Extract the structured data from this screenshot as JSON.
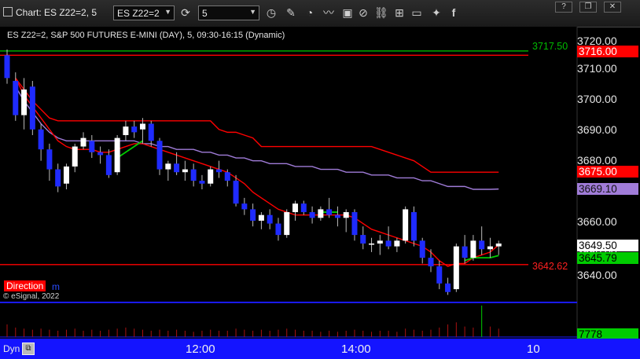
{
  "window": {
    "title": "Chart: ES Z22=2, 5",
    "symbol_value": "ES Z22=2",
    "interval_value": "5",
    "buttons": {
      "help": "?",
      "restore": "❐",
      "close": "✕"
    }
  },
  "chart": {
    "subtitle": "ES Z22=2, S&P 500 FUTURES E-MINI (DAY), 5, 09:30-16:15 (Dynamic)",
    "price_axis": [
      "3720.00",
      "3710.00",
      "3700.00",
      "3690.00",
      "3680.00",
      "3670.00",
      "3660.00",
      "3650.00",
      "3640.00"
    ],
    "time_axis": [
      "12:00",
      "14:00",
      "10"
    ],
    "tags": {
      "green_line": "3717.50",
      "red_top": "3716.00",
      "red_mid": "3675.00",
      "purple": "3669.10",
      "last": "3649.50",
      "green_ma": "3645.79",
      "red_low": "3642.62",
      "volume": "7778"
    },
    "direction_label": "Direction",
    "direction_suffix": "m",
    "copyright": "© eSignal, 2022",
    "footer_label": "Dyn",
    "colors": {
      "red": "#ff0000",
      "purple": "#a07cd8",
      "green": "#00cc00",
      "blue_candle": "#1f2bff",
      "footer": "#1414ff"
    }
  },
  "chart_data": {
    "type": "line",
    "y_range": [
      3631,
      3726
    ],
    "candles": [
      [
        3716,
        3718,
        3706,
        3708
      ],
      [
        3707,
        3710,
        3693,
        3695
      ],
      [
        3695,
        3708,
        3690,
        3704
      ],
      [
        3705,
        3707,
        3688,
        3690
      ],
      [
        3690,
        3692,
        3679,
        3683
      ],
      [
        3683,
        3685,
        3672,
        3676
      ],
      [
        3676,
        3678,
        3668,
        3670
      ],
      [
        3671,
        3678,
        3669,
        3677
      ],
      [
        3677,
        3685,
        3675,
        3684
      ],
      [
        3684,
        3689,
        3683,
        3687
      ],
      [
        3686,
        3688,
        3680,
        3682
      ],
      [
        3682,
        3684,
        3678,
        3681
      ],
      [
        3681,
        3683,
        3673,
        3674
      ],
      [
        3675,
        3688,
        3674,
        3687
      ],
      [
        3688,
        3693,
        3686,
        3691
      ],
      [
        3691,
        3693,
        3687,
        3689
      ],
      [
        3690,
        3694,
        3685,
        3692
      ],
      [
        3692,
        3693,
        3684,
        3686
      ],
      [
        3686,
        3687,
        3674,
        3676
      ],
      [
        3676,
        3679,
        3672,
        3678
      ],
      [
        3678,
        3682,
        3674,
        3675
      ],
      [
        3675,
        3679,
        3672,
        3676
      ],
      [
        3676,
        3678,
        3670,
        3672
      ],
      [
        3672,
        3674,
        3669,
        3671
      ],
      [
        3671,
        3677,
        3670,
        3676
      ],
      [
        3676,
        3679,
        3673,
        3675
      ],
      [
        3675,
        3676,
        3670,
        3672
      ],
      [
        3672,
        3674,
        3663,
        3664
      ],
      [
        3664,
        3666,
        3660,
        3662
      ],
      [
        3662,
        3664,
        3656,
        3658
      ],
      [
        3658,
        3661,
        3655,
        3660
      ],
      [
        3660,
        3662,
        3655,
        3657
      ],
      [
        3657,
        3659,
        3651,
        3653
      ],
      [
        3653,
        3662,
        3652,
        3661
      ],
      [
        3661,
        3665,
        3658,
        3664
      ],
      [
        3664,
        3665,
        3660,
        3661
      ],
      [
        3661,
        3663,
        3657,
        3659
      ],
      [
        3659,
        3663,
        3658,
        3662
      ],
      [
        3662,
        3666,
        3659,
        3660
      ],
      [
        3660,
        3663,
        3656,
        3659
      ],
      [
        3659,
        3662,
        3654,
        3661
      ],
      [
        3661,
        3662,
        3651,
        3653
      ],
      [
        3653,
        3656,
        3648,
        3650
      ],
      [
        3650,
        3652,
        3647,
        3650
      ],
      [
        3650,
        3653,
        3646,
        3651
      ],
      [
        3651,
        3656,
        3648,
        3649
      ],
      [
        3649,
        3652,
        3647,
        3651
      ],
      [
        3651,
        3663,
        3650,
        3662
      ],
      [
        3661,
        3663,
        3649,
        3651
      ],
      [
        3651,
        3652,
        3643,
        3645
      ],
      [
        3645,
        3648,
        3640,
        3642
      ],
      [
        3642,
        3644,
        3634,
        3636
      ],
      [
        3636,
        3638,
        3632,
        3633
      ],
      [
        3634,
        3650,
        3633,
        3649
      ],
      [
        3649,
        3653,
        3643,
        3645
      ],
      [
        3645,
        3653,
        3644,
        3651
      ],
      [
        3651,
        3656,
        3646,
        3648
      ],
      [
        3648,
        3652,
        3645,
        3649
      ],
      [
        3649,
        3651,
        3646,
        3650
      ]
    ],
    "volume": [
      12,
      9,
      8,
      7,
      8,
      7,
      6,
      7,
      8,
      6,
      7,
      6,
      7,
      8,
      9,
      8,
      7,
      6,
      7,
      6,
      7,
      6,
      5,
      6,
      7,
      6,
      6,
      8,
      7,
      6,
      7,
      6,
      7,
      8,
      7,
      6,
      6,
      5,
      6,
      5,
      6,
      7,
      6,
      5,
      6,
      6,
      5,
      8,
      7,
      6,
      7,
      9,
      12,
      14,
      10,
      9,
      30,
      10,
      8
    ],
    "series": [
      {
        "values": [
          3716,
          3716,
          3716,
          3716,
          3716,
          3716,
          3716,
          3716,
          3716,
          3716,
          3716,
          3716,
          3716,
          3716,
          3716,
          3716,
          3716,
          3716,
          3716,
          3716,
          3716,
          3716,
          3716,
          3716,
          3716,
          3716,
          3716,
          3716,
          3716,
          3716,
          3716,
          3716,
          3716,
          3716,
          3716,
          3716,
          3716,
          3716,
          3716,
          3716,
          3716,
          3716,
          3716,
          3716,
          3716,
          3716,
          3716,
          3716,
          3716,
          3716,
          3716,
          3716,
          3716,
          3716,
          3716,
          3716,
          3716,
          3716,
          3716
        ]
      },
      {
        "values": [
          3717.5,
          3717.5,
          3717.5,
          3717.5,
          3717.5,
          3717.5,
          3717.5,
          3717.5,
          3717.5,
          3717.5,
          3717.5,
          3717.5,
          3717.5,
          3717.5,
          3717.5,
          3717.5,
          3717.5,
          3717.5,
          3717.5,
          3717.5,
          3717.5,
          3717.5,
          3717.5,
          3717.5,
          3717.5,
          3717.5,
          3717.5,
          3717.5,
          3717.5,
          3717.5,
          3717.5,
          3717.5,
          3717.5,
          3717.5,
          3717.5,
          3717.5,
          3717.5,
          3717.5,
          3717.5,
          3717.5,
          3717.5,
          3717.5,
          3717.5,
          3717.5,
          3717.5,
          3717.5,
          3717.5,
          3717.5,
          3717.5,
          3717.5,
          3717.5,
          3717.5,
          3717.5,
          3717.5,
          3717.5,
          3717.5,
          3717.5,
          3717.5,
          3717.5
        ]
      },
      {
        "values": [
          3642.62,
          3642.62,
          3642.62,
          3642.62,
          3642.62,
          3642.62,
          3642.62,
          3642.62,
          3642.62,
          3642.62,
          3642.62,
          3642.62,
          3642.62,
          3642.62,
          3642.62,
          3642.62,
          3642.62,
          3642.62,
          3642.62,
          3642.62,
          3642.62,
          3642.62,
          3642.62,
          3642.62,
          3642.62,
          3642.62,
          3642.62,
          3642.62,
          3642.62,
          3642.62,
          3642.62,
          3642.62,
          3642.62,
          3642.62,
          3642.62,
          3642.62,
          3642.62,
          3642.62,
          3642.62,
          3642.62,
          3642.62,
          3642.62,
          3642.62,
          3642.62,
          3642.62,
          3642.62,
          3642.62,
          3642.62,
          3642.62,
          3642.62,
          3642.62,
          3642.62,
          3642.62,
          3642.62,
          3642.62,
          3642.62,
          3642.62,
          3642.62,
          3642.62
        ]
      },
      {
        "values": [
          null,
          3708,
          3704,
          3700,
          3697,
          3694,
          3693,
          3693,
          3693,
          3693,
          3693,
          3693,
          3693,
          3693,
          3693,
          3693,
          3693,
          3693,
          3693,
          3693,
          3693,
          3693,
          3693,
          3693,
          3693,
          3690,
          3689,
          3689,
          3688,
          3687,
          3684,
          3684,
          3684,
          3684,
          3684,
          3684,
          3684,
          3684,
          3684,
          3684,
          3684,
          3684,
          3684,
          3684,
          3683,
          3682,
          3681,
          3680,
          3679,
          3677,
          3675,
          3675,
          3675,
          3675,
          3675,
          3675,
          3675,
          3675,
          3675
        ]
      },
      {
        "values": [
          null,
          3705,
          3700,
          3696,
          3692,
          3689,
          3687,
          3686,
          3686,
          3686,
          3686,
          3686,
          3686,
          3686,
          3686,
          3686,
          3685,
          3685,
          3684,
          3684,
          3683,
          3683,
          3683,
          3682,
          3682,
          3681,
          3681,
          3680,
          3680,
          3679,
          3679,
          3678,
          3678,
          3678,
          3677,
          3677,
          3677,
          3676,
          3676,
          3676,
          3675,
          3675,
          3675,
          3674,
          3674,
          3674,
          3673,
          3673,
          3673,
          3672,
          3672,
          3671,
          3670,
          3670,
          3670,
          3669,
          3669,
          3669,
          3669.1
        ]
      },
      {
        "values": [
          null,
          3708,
          3702,
          3698,
          3694,
          3690,
          3686,
          3684,
          3683,
          3683,
          3683,
          3682,
          3682,
          3683,
          3684,
          3685,
          3685,
          3684,
          3683,
          3682,
          3681,
          3680,
          3679,
          3678,
          3677,
          3676,
          3675,
          3673,
          3671,
          3668,
          3666,
          3664,
          3662,
          3661,
          3660,
          3660,
          3660,
          3660,
          3660,
          3660,
          3660,
          3659,
          3657,
          3655,
          3654,
          3653,
          3652,
          3651,
          3650,
          3649,
          3647,
          3644,
          3642,
          3643,
          3643,
          3645,
          3646,
          3647,
          3649.5
        ]
      },
      {
        "values": [
          null,
          null,
          null,
          null,
          null,
          null,
          null,
          null,
          null,
          null,
          null,
          null,
          null,
          3680,
          3682,
          3684,
          3686,
          null,
          null,
          null,
          null,
          null,
          null,
          null,
          null,
          null,
          null,
          null,
          null,
          null,
          null,
          null,
          null,
          null,
          null,
          null,
          null,
          3661,
          3661,
          3661,
          null,
          null,
          null,
          null,
          null,
          null,
          null,
          null,
          null,
          null,
          null,
          null,
          null,
          null,
          3644,
          3645,
          3645,
          3645,
          3645.79
        ]
      }
    ]
  }
}
